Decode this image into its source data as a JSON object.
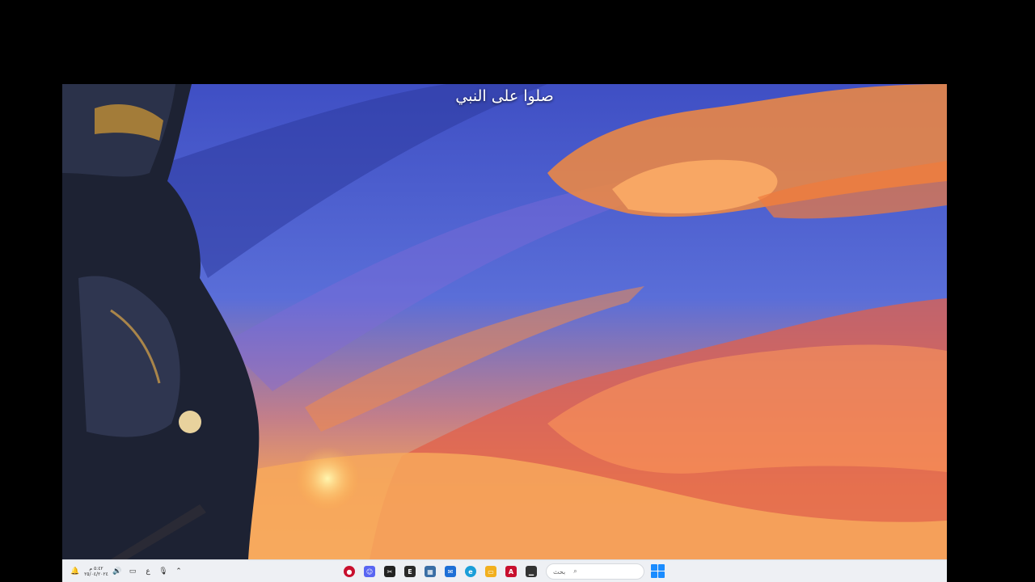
{
  "desktop": {
    "caption": "صلوا على النبي"
  },
  "taskbar": {
    "search": {
      "placeholder": "بحث"
    },
    "clock": {
      "time": "٥:٤٢ م",
      "date": "٢٥/٠٤/٢٠٢٤"
    },
    "tray_items": [
      {
        "name": "notification-icon",
        "glyph": "🔔"
      },
      {
        "name": "volume-icon",
        "glyph": "🔊"
      },
      {
        "name": "display-icon",
        "glyph": "▭"
      },
      {
        "name": "language-indicator",
        "glyph": "ع"
      },
      {
        "name": "microphone-icon",
        "glyph": "🎙"
      },
      {
        "name": "show-hidden-icons",
        "glyph": "^"
      }
    ],
    "pinned_apps": [
      {
        "name": "app-red-ball-icon",
        "color": "#c8102e",
        "glyph": "●"
      },
      {
        "name": "app-discord-icon",
        "color": "#5865f2",
        "glyph": "☺"
      },
      {
        "name": "app-capcut-icon",
        "color": "#222222",
        "glyph": "✂"
      },
      {
        "name": "app-epic-games-icon",
        "color": "#2a2a2a",
        "glyph": "E"
      },
      {
        "name": "app-calculator-icon",
        "color": "#3a6ea5",
        "glyph": "▦"
      },
      {
        "name": "app-mail-icon",
        "color": "#1d6fd6",
        "glyph": "✉"
      },
      {
        "name": "app-edge-icon",
        "color": "#1a9ed8",
        "glyph": "e"
      },
      {
        "name": "app-file-explorer-icon",
        "color": "#f2b01e",
        "glyph": "▭"
      },
      {
        "name": "app-acrobat-icon",
        "color": "#c8102e",
        "glyph": "A"
      },
      {
        "name": "app-terminal-icon",
        "color": "#333333",
        "glyph": "▁"
      }
    ],
    "accent_color": "#1a8cff"
  }
}
